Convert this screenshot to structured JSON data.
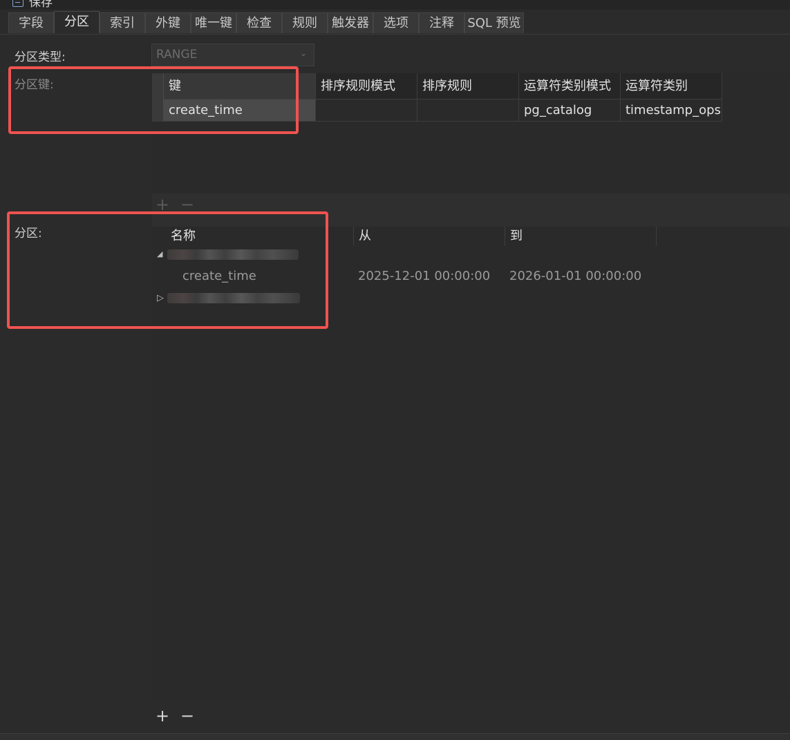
{
  "window": {
    "save_label": "保存",
    "save_icon": "save-icon"
  },
  "tabs": [
    {
      "label": "字段",
      "active": false
    },
    {
      "label": "分区",
      "active": true
    },
    {
      "label": "索引",
      "active": false
    },
    {
      "label": "外键",
      "active": false
    },
    {
      "label": "唯一键",
      "active": false
    },
    {
      "label": "检查",
      "active": false
    },
    {
      "label": "规则",
      "active": false
    },
    {
      "label": "触发器",
      "active": false
    },
    {
      "label": "选项",
      "active": false
    },
    {
      "label": "注释",
      "active": false
    },
    {
      "label": "SQL 预览",
      "active": false
    }
  ],
  "partition_type": {
    "label": "分区类型:",
    "value": "RANGE"
  },
  "partition_key": {
    "label": "分区键:",
    "columns": [
      "键",
      "排序规则模式",
      "排序规则",
      "运算符类别模式",
      "运算符类别"
    ],
    "rows": [
      [
        "create_time",
        "",
        "",
        "pg_catalog",
        "timestamp_ops"
      ]
    ]
  },
  "partitions": {
    "label": "分区:",
    "columns": [
      "名称",
      "从",
      "到"
    ],
    "rows": [
      {
        "key": "create_time",
        "from": "2025-12-01 00:00:00",
        "to": "2026-01-01 00:00:00"
      }
    ]
  },
  "colors": {
    "annotation": "#ef5350",
    "background": "#2b2b2b"
  }
}
